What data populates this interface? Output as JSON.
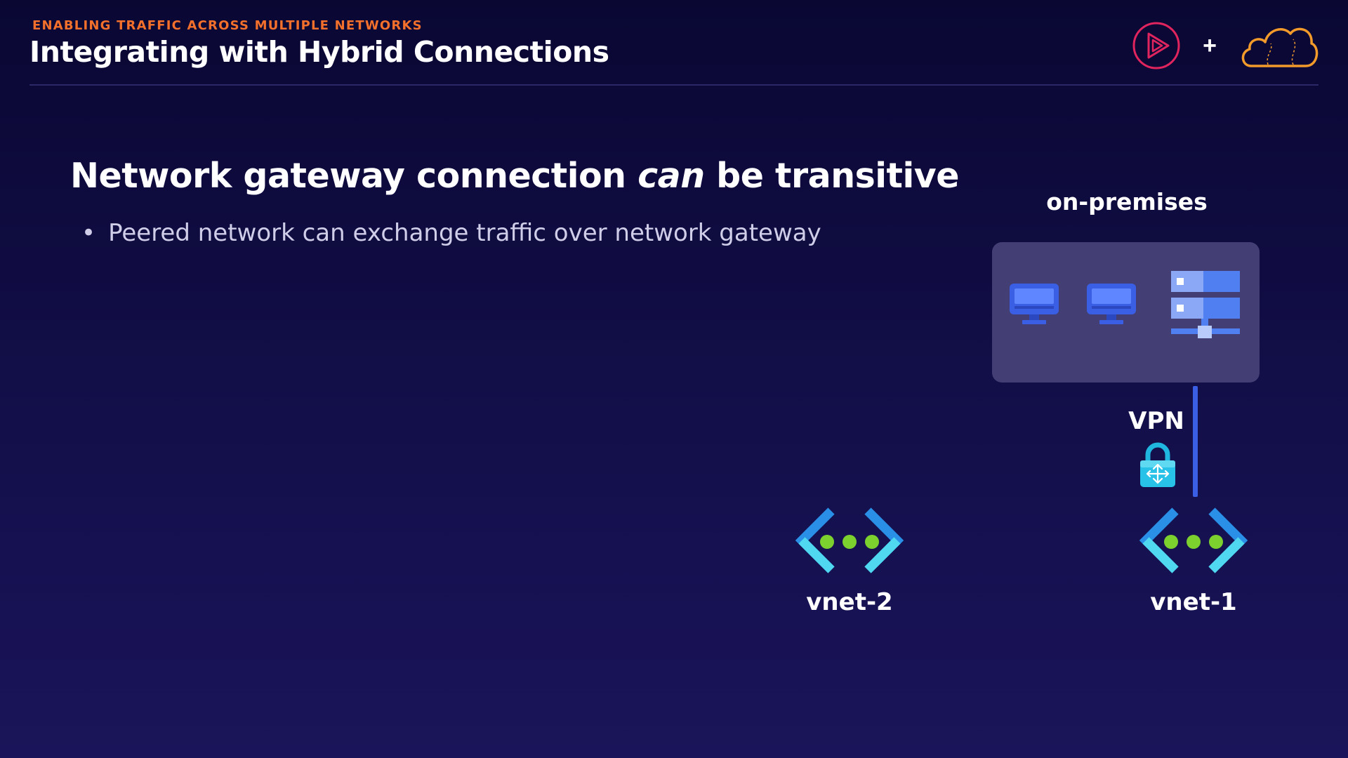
{
  "header": {
    "eyebrow": "ENABLING TRAFFIC ACROSS MULTIPLE NETWORKS",
    "title": "Integrating with Hybrid Connections",
    "logo_plus": "+"
  },
  "content": {
    "headline_before": "Network gateway connection ",
    "headline_em": "can",
    "headline_after": " be transitive",
    "bullet_dot": "•",
    "bullet": "Peered network can exchange traffic over network gateway"
  },
  "diagram": {
    "onprem_label": "on-premises",
    "vpn_label": "VPN",
    "vnet2_label": "vnet-2",
    "vnet1_label": "vnet-1"
  },
  "icons": {
    "play_logo": "play-logo-icon",
    "cloud_logo": "cloud-logo-icon",
    "monitor": "monitor-icon",
    "server": "server-icon",
    "lock": "vpn-lock-icon",
    "vnet": "virtual-network-icon"
  },
  "colors": {
    "accent": "#f2702b",
    "vpn_line": "#3a5fe4",
    "onprem_box": "#433f74",
    "vnet_dots": "#7dd12f",
    "vnet_chevrons": "#2a8fe6"
  }
}
